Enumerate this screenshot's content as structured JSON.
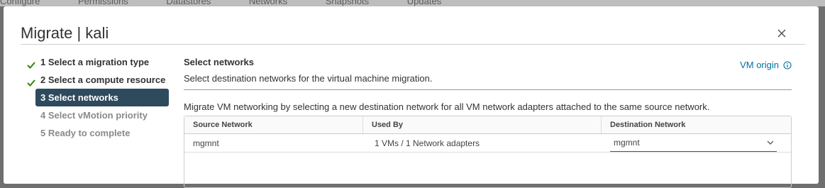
{
  "background_app": {
    "menu_items": [
      "Configure",
      "Permissions",
      "Datastores",
      "Networks",
      "Snapshots",
      "Updates"
    ]
  },
  "dialog": {
    "title": "Migrate | kali"
  },
  "steps": [
    {
      "label": "1 Select a migration type",
      "state": "done"
    },
    {
      "label": "2 Select a compute resource",
      "state": "done"
    },
    {
      "label": "3 Select networks",
      "state": "active"
    },
    {
      "label": "4 Select vMotion priority",
      "state": "pending"
    },
    {
      "label": "5 Ready to complete",
      "state": "pending"
    }
  ],
  "section": {
    "title": "Select networks",
    "description": "Select destination networks for the virtual machine migration.",
    "vm_origin_link": "VM origin",
    "instructions": "Migrate VM networking by selecting a new destination network for all VM network adapters attached to the same source network."
  },
  "table": {
    "headers": [
      "Source Network",
      "Used By",
      "Destination Network"
    ],
    "rows": [
      {
        "source": "mgmnt",
        "used_by": "1 VMs / 1 Network adapters",
        "destination": "mgmnt"
      }
    ]
  },
  "colors": {
    "accent_link": "#0072a3",
    "active_step_bg": "#2e4a5d",
    "check_green": "#318700"
  }
}
